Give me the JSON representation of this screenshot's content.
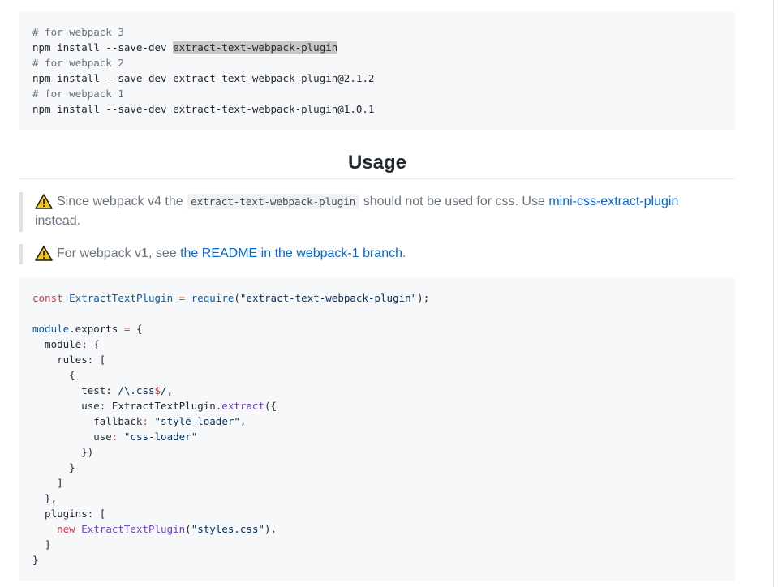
{
  "install_block": {
    "lines": [
      {
        "comment": "# for webpack 3"
      },
      {
        "cmd": "npm install --save-dev ",
        "pkg": "extract-text-webpack-plugin"
      },
      {
        "comment": "# for webpack 2"
      },
      {
        "cmd": "npm install --save-dev extract-text-webpack-plugin@2.1.2"
      },
      {
        "comment": "# for webpack 1"
      },
      {
        "cmd": "npm install --save-dev extract-text-webpack-plugin@1.0.1"
      }
    ]
  },
  "usage": {
    "heading": "Usage",
    "note_1": {
      "icon": "warning-icon",
      "text_before": "Since webpack v4 the ",
      "code": "extract-text-webpack-plugin",
      "text_middle": " should not be used for css. Use ",
      "link": "mini-css-extract-plugin",
      "text_after": "instead."
    },
    "note_2": {
      "icon": "warning-icon",
      "text_before": "For webpack v1, see ",
      "link": "the README in the webpack-1 branch",
      "text_after": "."
    }
  },
  "code": {
    "l1": {
      "kw": "const",
      "name": "ExtractTextPlugin",
      "eq": "=",
      "req": "require",
      "open": "(",
      "str": "\"extract-text-webpack-plugin\"",
      "close": ");"
    },
    "l3": {
      "mod": "module",
      "dot": ".exports",
      "eq": "=",
      "brace": "{"
    },
    "l4": "  module: {",
    "l5": "    rules: [",
    "l6": "      {",
    "l7": {
      "pre": "        test: ",
      "re_a": "/\\.css",
      "re_b": "$",
      "re_c": "/",
      "post": ","
    },
    "l8": {
      "pre": "        use: ExtractTextPlugin.",
      "fn": "extract",
      "post": "({"
    },
    "l9": {
      "pre": "          fallback",
      "colon": ":",
      "str": "\"style-loader\"",
      "post": ","
    },
    "l10": {
      "pre": "          use",
      "colon": ":",
      "str": "\"css-loader\""
    },
    "l11": "        })",
    "l12": "      }",
    "l13": "    ]",
    "l14": "  },",
    "l15": "  plugins: [",
    "l16": {
      "pre": "    ",
      "kw": "new",
      "cls": "ExtractTextPlugin",
      "open": "(",
      "str": "\"styles.css\"",
      "post": "),"
    },
    "l17": "  ]",
    "l18": "}"
  },
  "colors": {
    "warning": "#f5c518",
    "link": "#0366d6",
    "keyword": "#d73a49",
    "entity": "#005cc5",
    "function": "#6f42c1"
  }
}
